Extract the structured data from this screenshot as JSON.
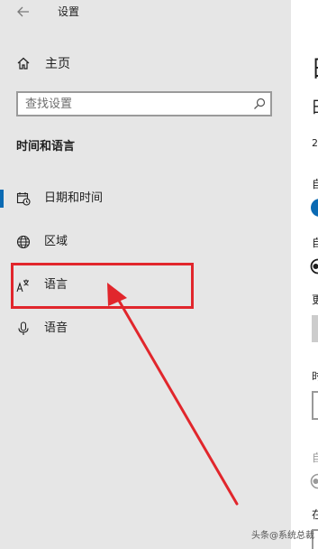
{
  "window": {
    "title": "设置"
  },
  "sidebar": {
    "home_label": "主页",
    "section_title": "时间和语言",
    "items": [
      {
        "label": "日期和时间",
        "icon": "calendar-clock-icon",
        "active": true
      },
      {
        "label": "区域",
        "icon": "globe-icon",
        "active": false
      },
      {
        "label": "语言",
        "icon": "language-icon",
        "active": false
      },
      {
        "label": "语音",
        "icon": "microphone-icon",
        "active": false
      }
    ]
  },
  "search": {
    "placeholder": "查找设置"
  },
  "main": {
    "heading_fragment": "日",
    "subheading_fragment": "日",
    "date_fragment": "2",
    "lines": [
      "自",
      "自",
      "更",
      "时",
      "自",
      "在"
    ]
  },
  "watermark": {
    "text": "头条@系统总裁"
  },
  "colors": {
    "accent": "#0b6ab3",
    "annotation": "#e1262c",
    "sidebar_bg": "#e6e6e6"
  }
}
